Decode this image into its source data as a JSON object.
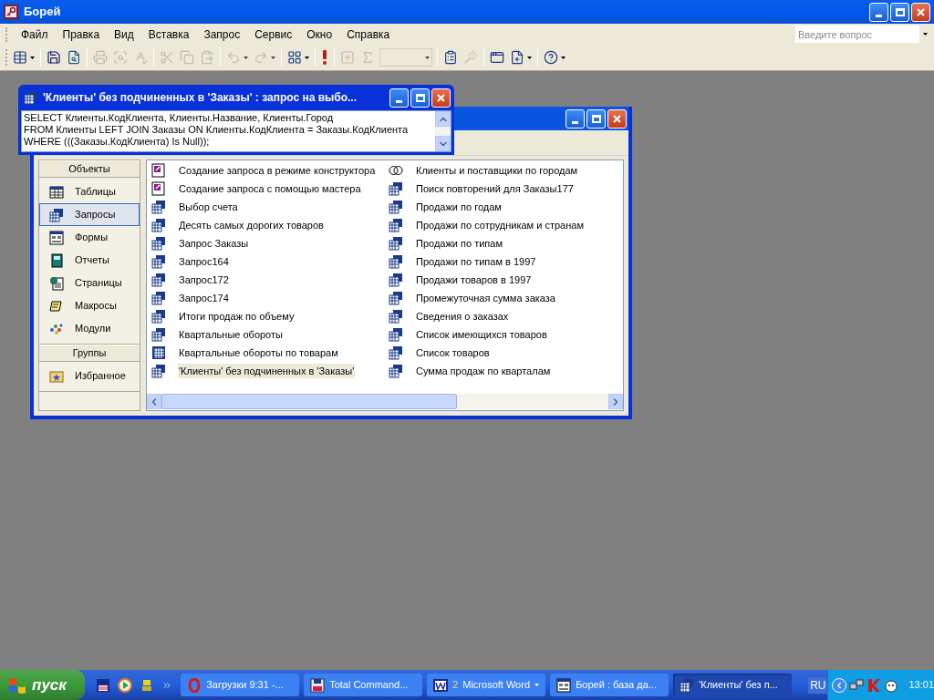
{
  "app": {
    "title": "Борей"
  },
  "menu": [
    "Файл",
    "Правка",
    "Вид",
    "Вставка",
    "Запрос",
    "Сервис",
    "Окно",
    "Справка"
  ],
  "help_box": {
    "placeholder": "Введите вопрос"
  },
  "toolbar": [
    {
      "items": [
        {
          "kind": "view",
          "disabled": false,
          "dropdown": true
        }
      ]
    },
    {
      "items": [
        {
          "kind": "save",
          "disabled": false,
          "dropdown": false
        },
        {
          "kind": "search",
          "disabled": false,
          "dropdown": false
        }
      ]
    },
    {
      "items": [
        {
          "kind": "print",
          "disabled": true,
          "dropdown": false
        },
        {
          "kind": "preview",
          "disabled": true,
          "dropdown": false
        },
        {
          "kind": "spell",
          "disabled": true,
          "dropdown": false
        }
      ]
    },
    {
      "items": [
        {
          "kind": "cut",
          "disabled": true,
          "dropdown": false
        },
        {
          "kind": "copy",
          "disabled": true,
          "dropdown": false
        },
        {
          "kind": "paste",
          "disabled": true,
          "dropdown": false
        }
      ]
    },
    {
      "items": [
        {
          "kind": "undo",
          "disabled": true,
          "dropdown": true
        },
        {
          "kind": "redo",
          "disabled": true,
          "dropdown": true
        }
      ]
    },
    {
      "items": [
        {
          "kind": "querytype",
          "disabled": false,
          "dropdown": true
        }
      ]
    },
    {
      "items": [
        {
          "kind": "run",
          "disabled": false,
          "dropdown": false
        }
      ]
    },
    {
      "items": [
        {
          "kind": "addtable",
          "disabled": true,
          "dropdown": false
        },
        {
          "kind": "totals",
          "disabled": true,
          "dropdown": false
        },
        {
          "kind": "combo",
          "disabled": true,
          "dropdown": false
        }
      ]
    },
    {
      "items": [
        {
          "kind": "properties",
          "disabled": false,
          "dropdown": false
        },
        {
          "kind": "build",
          "disabled": true,
          "dropdown": false
        }
      ]
    },
    {
      "items": [
        {
          "kind": "dbwindow",
          "disabled": false,
          "dropdown": false
        },
        {
          "kind": "newobject",
          "disabled": false,
          "dropdown": true
        }
      ]
    },
    {
      "items": [
        {
          "kind": "help",
          "disabled": false,
          "dropdown": true
        }
      ]
    }
  ],
  "db_window": {
    "sidebar": [
      {
        "title": "Объекты",
        "items": [
          {
            "label": "Таблицы",
            "kind": "table",
            "selected": false
          },
          {
            "label": "Запросы",
            "kind": "query",
            "selected": true
          },
          {
            "label": "Формы",
            "kind": "form",
            "selected": false
          },
          {
            "label": "Отчеты",
            "kind": "report",
            "selected": false
          },
          {
            "label": "Страницы",
            "kind": "page",
            "selected": false
          },
          {
            "label": "Макросы",
            "kind": "macro",
            "selected": false
          },
          {
            "label": "Модули",
            "kind": "module",
            "selected": false
          }
        ]
      },
      {
        "title": "Группы",
        "items": [
          {
            "label": "Избранное",
            "kind": "favorites",
            "selected": false
          }
        ]
      }
    ],
    "items": [
      {
        "label": "Создание запроса в режиме конструктора",
        "kind": "wizard",
        "selected": false
      },
      {
        "label": "Создание запроса с помощью мастера",
        "kind": "wizard",
        "selected": false
      },
      {
        "label": "Выбор счета",
        "kind": "query",
        "selected": false
      },
      {
        "label": "Десять самых дорогих товаров",
        "kind": "query",
        "selected": false
      },
      {
        "label": "Запрос Заказы",
        "kind": "query",
        "selected": false
      },
      {
        "label": "Запрос164",
        "kind": "query",
        "selected": false
      },
      {
        "label": "Запрос172",
        "kind": "query",
        "selected": false
      },
      {
        "label": "Запрос174",
        "kind": "query",
        "selected": false
      },
      {
        "label": "Итоги продаж по объему",
        "kind": "query",
        "selected": false
      },
      {
        "label": "Квартальные обороты",
        "kind": "query",
        "selected": false
      },
      {
        "label": "Квартальные обороты по товарам",
        "kind": "crosstab",
        "selected": false
      },
      {
        "label": "'Клиенты' без подчиненных в 'Заказы'",
        "kind": "query",
        "selected": true
      },
      {
        "label": "Клиенты и поставщики по городам",
        "kind": "union",
        "selected": false
      },
      {
        "label": "Поиск повторений для Заказы177",
        "kind": "query",
        "selected": false
      },
      {
        "label": "Продажи по годам",
        "kind": "query",
        "selected": false
      },
      {
        "label": "Продажи по сотрудникам и странам",
        "kind": "query",
        "selected": false
      },
      {
        "label": "Продажи по типам",
        "kind": "query",
        "selected": false
      },
      {
        "label": "Продажи по типам в 1997",
        "kind": "query",
        "selected": false
      },
      {
        "label": "Продажи товаров в 1997",
        "kind": "query",
        "selected": false
      },
      {
        "label": "Промежуточная сумма заказа",
        "kind": "query",
        "selected": false
      },
      {
        "label": "Сведения о заказах",
        "kind": "query",
        "selected": false
      },
      {
        "label": "Список имеющихся товаров",
        "kind": "query",
        "selected": false
      },
      {
        "label": "Список товаров",
        "kind": "query",
        "selected": false
      },
      {
        "label": "Сумма продаж по кварталам",
        "kind": "query",
        "selected": false
      }
    ]
  },
  "query_window": {
    "title": "'Клиенты' без подчиненных в 'Заказы' : запрос на выбо...",
    "sql": "SELECT Клиенты.КодКлиента, Клиенты.Название, Клиенты.Город\nFROM Клиенты LEFT JOIN Заказы ON Клиенты.КодКлиента = Заказы.КодКлиента\nWHERE (((Заказы.КодКлиента) Is Null));"
  },
  "taskbar": {
    "start": "пуск",
    "tasks": [
      {
        "label": "Загрузки 9:31 -...",
        "kind": "browser",
        "group": false,
        "selected": false
      },
      {
        "label": "Total Command...",
        "kind": "disk",
        "group": false,
        "selected": false
      },
      {
        "label": "Microsoft Word",
        "kind": "word",
        "count": "2",
        "group": true,
        "selected": false
      },
      {
        "label": "Борей : база да...",
        "kind": "form",
        "group": false,
        "selected": false
      },
      {
        "label": "'Клиенты' без п...",
        "kind": "query",
        "group": false,
        "selected": true
      }
    ],
    "language": "RU",
    "clock": "13:01"
  }
}
